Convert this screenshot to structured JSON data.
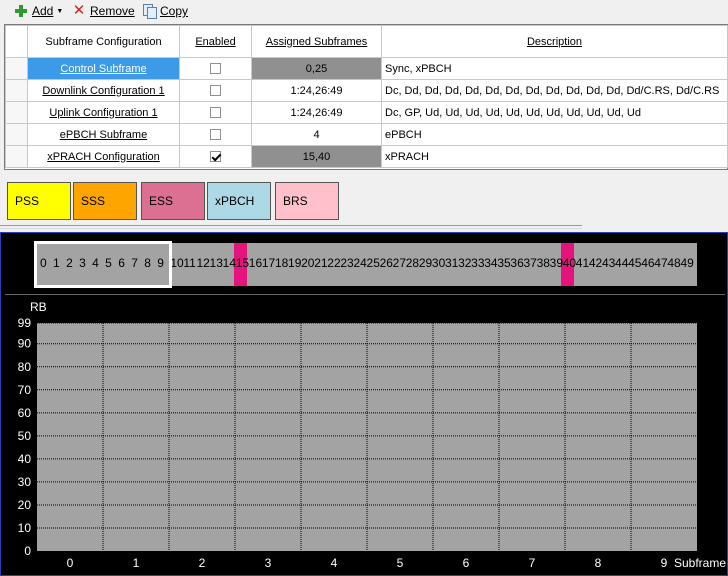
{
  "toolbar": {
    "add_label": "Add",
    "remove_label": "Remove",
    "copy_label": "Copy",
    "icons": [
      "plus-icon",
      "x-icon",
      "copy-icon"
    ]
  },
  "grid": {
    "headers": {
      "config": "Subframe Configuration",
      "enabled": "Enabled",
      "assigned": "Assigned Subframes",
      "description": "Description"
    },
    "rows": [
      {
        "name": "Control Subframe",
        "enabled": false,
        "assigned": "0,25",
        "description": "Sync, xPBCH"
      },
      {
        "name": "Downlink Configuration 1",
        "enabled": false,
        "assigned": "1:24,26:49",
        "description": "Dc, Dd, Dd, Dd, Dd, Dd, Dd, Dd, Dd, Dd, Dd, Dd, Dd/C.RS, Dd/C.RS"
      },
      {
        "name": "Uplink Configuration 1",
        "enabled": false,
        "assigned": "1:24,26:49",
        "description": "Dc, GP, Ud, Ud, Ud, Ud, Ud, Ud, Ud, Ud, Ud, Ud, Ud"
      },
      {
        "name": "ePBCH Subframe",
        "enabled": false,
        "assigned": "4",
        "description": "ePBCH"
      },
      {
        "name": "xPRACH Configuration",
        "enabled": true,
        "assigned": "15,40",
        "description": "xPRACH"
      }
    ]
  },
  "legend": [
    {
      "label": "PSS",
      "color": "#ffff00"
    },
    {
      "label": "SSS",
      "color": "#ffa500"
    },
    {
      "label": "ESS",
      "color": "#db7093"
    },
    {
      "label": "xPBCH",
      "color": "#add8e6"
    },
    {
      "label": "BRS",
      "color": "#ffc0cb"
    }
  ],
  "subframe_strip": {
    "count": 50,
    "highlighted": [
      15,
      40
    ],
    "highlight_color": "#e4147c",
    "selected_range": [
      0,
      9
    ]
  },
  "chart_data": {
    "type": "heatmap",
    "ylabel": "RB",
    "xlabel": "Subframe",
    "x_ticks": [
      "0",
      "1",
      "2",
      "3",
      "4",
      "5",
      "6",
      "7",
      "8",
      "9"
    ],
    "y_ticks": [
      "0",
      "10",
      "20",
      "30",
      "40",
      "50",
      "60",
      "70",
      "80",
      "90",
      "99"
    ],
    "xlim": [
      0,
      10
    ],
    "ylim": [
      0,
      99
    ],
    "grid": true,
    "cells": []
  }
}
